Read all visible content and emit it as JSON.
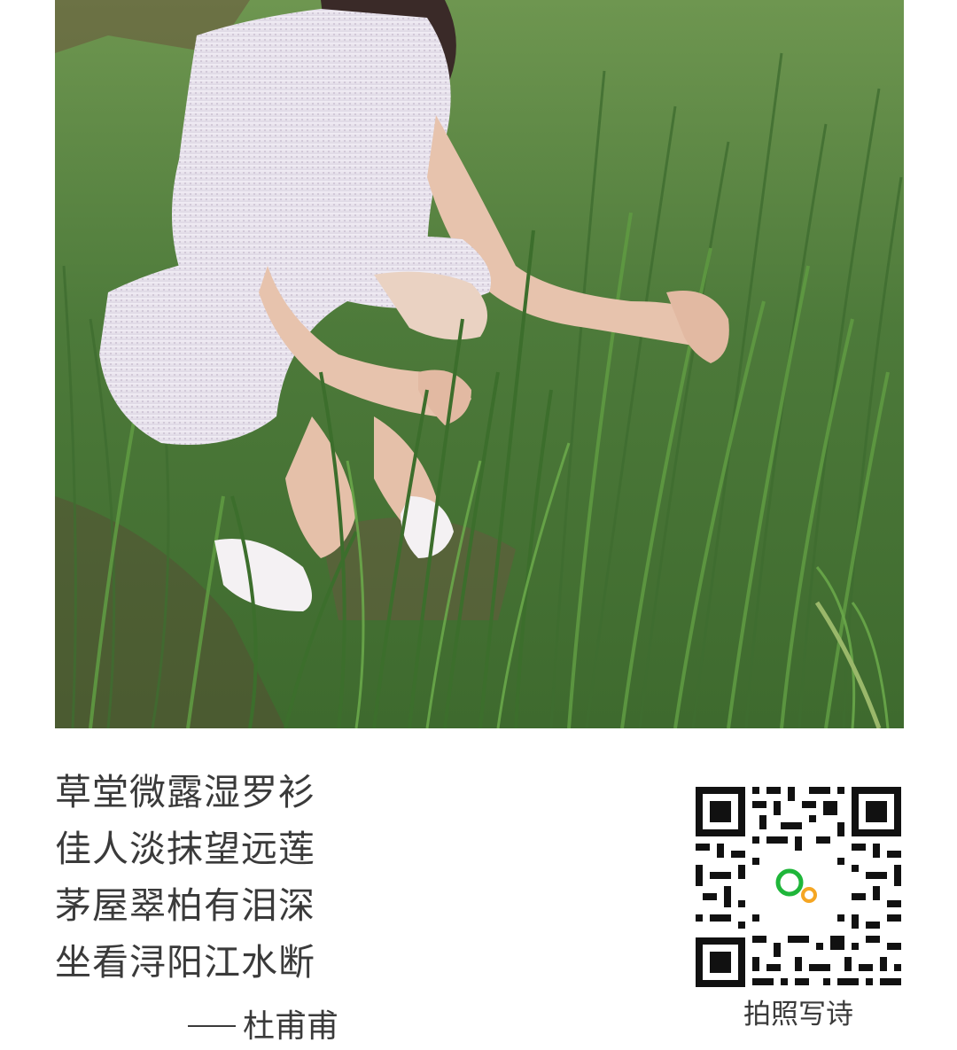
{
  "poem": {
    "lines": [
      "草堂微露湿罗衫",
      "佳人淡抹望远莲",
      "茅屋翠柏有泪深",
      "坐看浔阳江水断"
    ],
    "author": "杜甫甫"
  },
  "qr": {
    "caption": "拍照写诗"
  },
  "colors": {
    "text": "#3a3a3a",
    "grass": "#4f7a3c",
    "logo_green": "#1fb63a",
    "logo_orange": "#f5a623"
  }
}
